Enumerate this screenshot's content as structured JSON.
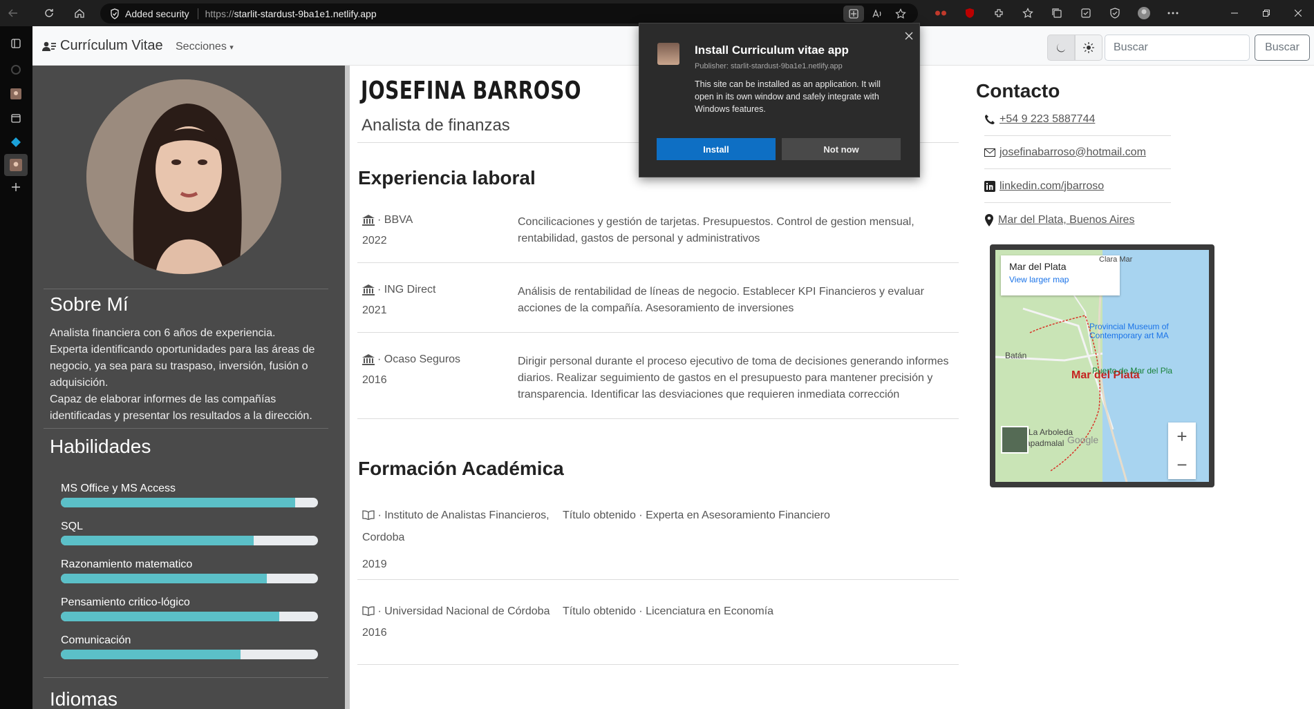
{
  "browser": {
    "security_label": "Added security",
    "url_scheme": "https://",
    "url_host": "starlit-stardust-9ba1e1.netlify.app"
  },
  "navbar": {
    "brand": "Currículum Vitae",
    "sections_label": "Secciones",
    "search_placeholder": "Buscar",
    "search_button": "Buscar"
  },
  "sidebar": {
    "about_title": "Sobre Mí",
    "about_lines": [
      "Analista financiera con 6 años de experiencia.",
      "Experta identificando oportunidades para las áreas de negocio, ya sea para su traspaso, inversión, fusión o adquisición.",
      "Capaz de elaborar informes de las compañías identificadas y presentar los resultados a la dirección."
    ],
    "skills_title": "Habilidades",
    "skills": [
      {
        "label": "MS Office y MS Access",
        "level": 0.91
      },
      {
        "label": "SQL",
        "level": 0.75
      },
      {
        "label": "Razonamiento matematico",
        "level": 0.8
      },
      {
        "label": "Pensamiento critico-lógico",
        "level": 0.85
      },
      {
        "label": "Comunicación",
        "level": 0.7
      }
    ],
    "languages_title": "Idiomas"
  },
  "main": {
    "name": "JOSEFINA BARROSO",
    "role": "Analista de finanzas",
    "experience_title": "Experiencia laboral",
    "experience": [
      {
        "company": "· BBVA",
        "year": "2022",
        "desc": "Concilicaciones y gestión de tarjetas. Presupuestos. Control de gestion mensual, rentabilidad, gastos de personal y administrativos"
      },
      {
        "company": "· ING Direct",
        "year": "2021",
        "desc": "Análisis de rentabilidad de líneas de negocio. Establecer KPI Financieros y evaluar acciones de la compañía. Asesoramiento de inversiones"
      },
      {
        "company": "· Ocaso Seguros",
        "year": "2016",
        "desc": "Dirigir personal durante el proceso ejecutivo de toma de decisiones generando informes diarios. Realizar seguimiento de gastos en el presupuesto para mantener precisión y transparencia. Identificar las desviaciones que requieren inmediata corrección"
      }
    ],
    "education_title": "Formación Académica",
    "education": [
      {
        "institution": "· Instituto de Analistas Financieros, Cordoba",
        "year": "2019",
        "desc": "Título obtenido · Experta en Asesoramiento Financiero"
      },
      {
        "institution": "· Universidad Nacional de Córdoba",
        "year": "2016",
        "desc": "Título obtenido · Licenciatura en Economía"
      }
    ]
  },
  "contact": {
    "title": "Contacto",
    "phone": "+54 9 223 5887744",
    "email": "josefinabarroso@hotmail.com",
    "linkedin": "linkedin.com/jbarroso",
    "location": "Mar del Plata, Buenos Aires",
    "map": {
      "place": "Mar del Plata",
      "larger_link": "View larger map",
      "city_label": "Mar del Plata",
      "labels": [
        "Batán",
        "Puerto de Mar del Pla",
        "Provincial Museum of Contemporary art MA",
        "La Arboleda",
        "apadmalal",
        "Clara Mar"
      ],
      "attribution": "Google"
    }
  },
  "install_popup": {
    "title": "Install Curriculum vitae app",
    "publisher": "Publisher: starlit-stardust-9ba1e1.netlify.app",
    "body": "This site can be installed as an application. It will open in its own window and safely integrate with Windows features.",
    "install_label": "Install",
    "notnow_label": "Not now"
  },
  "colors": {
    "accent": "#5bc0c8",
    "sidebar_bg": "#4a4a4a",
    "install_blue": "#0e6fc4"
  }
}
